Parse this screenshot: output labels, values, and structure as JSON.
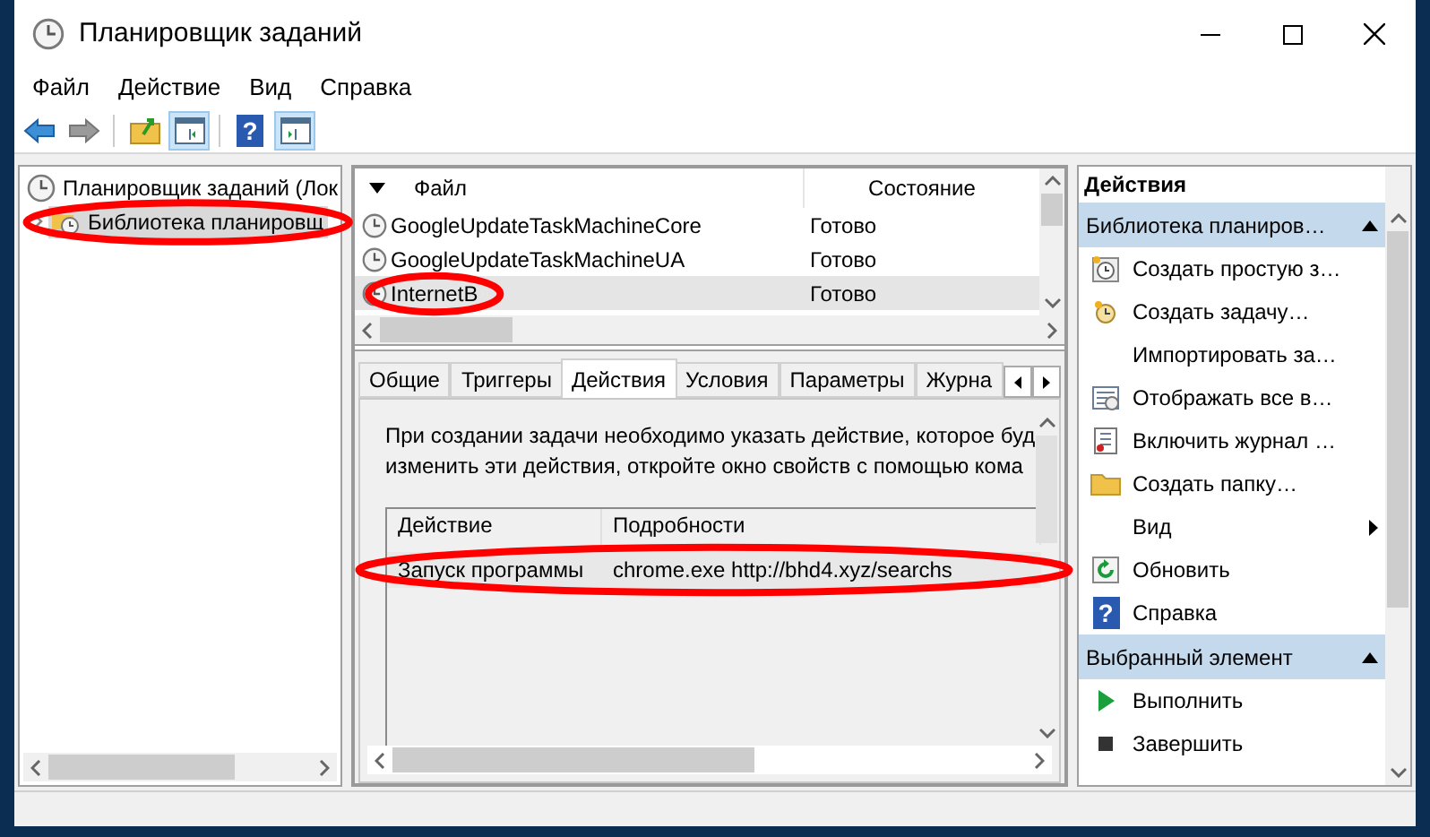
{
  "window": {
    "title": "Планировщик заданий"
  },
  "menu": [
    "Файл",
    "Действие",
    "Вид",
    "Справка"
  ],
  "toolbar": [
    {
      "kind": "back"
    },
    {
      "kind": "forward"
    },
    {
      "kind": "up"
    },
    {
      "kind": "pane-left"
    },
    {
      "kind": "help",
      "glyph": "?"
    },
    {
      "kind": "pane-right"
    }
  ],
  "tree": [
    {
      "label": "Планировщик заданий (Лок",
      "selected": false,
      "circled": false,
      "children": [
        {
          "label": "Библиотека планировщ",
          "selected": true,
          "circled": true,
          "expanded": false
        }
      ]
    }
  ],
  "tasks": {
    "columns": [
      "Файл",
      "Состояние"
    ],
    "rows": [
      {
        "name": "GoogleUpdateTaskMachineCore",
        "status": "Готово",
        "selected": false,
        "circled": false
      },
      {
        "name": "GoogleUpdateTaskMachineUA",
        "status": "Готово",
        "selected": false,
        "circled": false
      },
      {
        "name": "InternetB",
        "status": "Готово",
        "selected": true,
        "circled": true
      }
    ]
  },
  "tabs": [
    {
      "label": "Общие",
      "selected": false
    },
    {
      "label": "Триггеры",
      "selected": false
    },
    {
      "label": "Действия",
      "selected": true
    },
    {
      "label": "Условия",
      "selected": false
    },
    {
      "label": "Параметры",
      "selected": false
    },
    {
      "label": "Журна",
      "selected": false
    }
  ],
  "description": [
    "При создании задачи необходимо указать действие, которое буд",
    "изменить эти действия, откройте окно свойств с помощью кома"
  ],
  "actions_table": {
    "columns": [
      "Действие",
      "Подробности"
    ],
    "rows": [
      {
        "action": "Запуск программы",
        "details": "chrome.exe http://bhd4.xyz/searchs",
        "circled": true
      }
    ]
  },
  "actions_pane": {
    "title": "Действия",
    "groups": [
      {
        "title": "Библиотека планиров…",
        "items": [
          {
            "label": "Создать простую з…",
            "kind": "wizard"
          },
          {
            "label": "Создать задачу…",
            "kind": "task"
          },
          {
            "label": "Импортировать за…",
            "kind": "plain"
          },
          {
            "label": "Отображать все в…",
            "kind": "calendar"
          },
          {
            "label": "Включить журнал …",
            "kind": "log"
          },
          {
            "label": "Создать папку…",
            "kind": "folder"
          },
          {
            "label": "Вид",
            "kind": "submenu"
          },
          {
            "label": "Обновить",
            "kind": "refresh"
          },
          {
            "label": "Справка",
            "kind": "help",
            "glyph": "?"
          }
        ]
      },
      {
        "title": "Выбранный элемент",
        "items": [
          {
            "label": "Выполнить",
            "kind": "run"
          },
          {
            "label": "Завершить",
            "kind": "stop"
          }
        ]
      }
    ]
  }
}
